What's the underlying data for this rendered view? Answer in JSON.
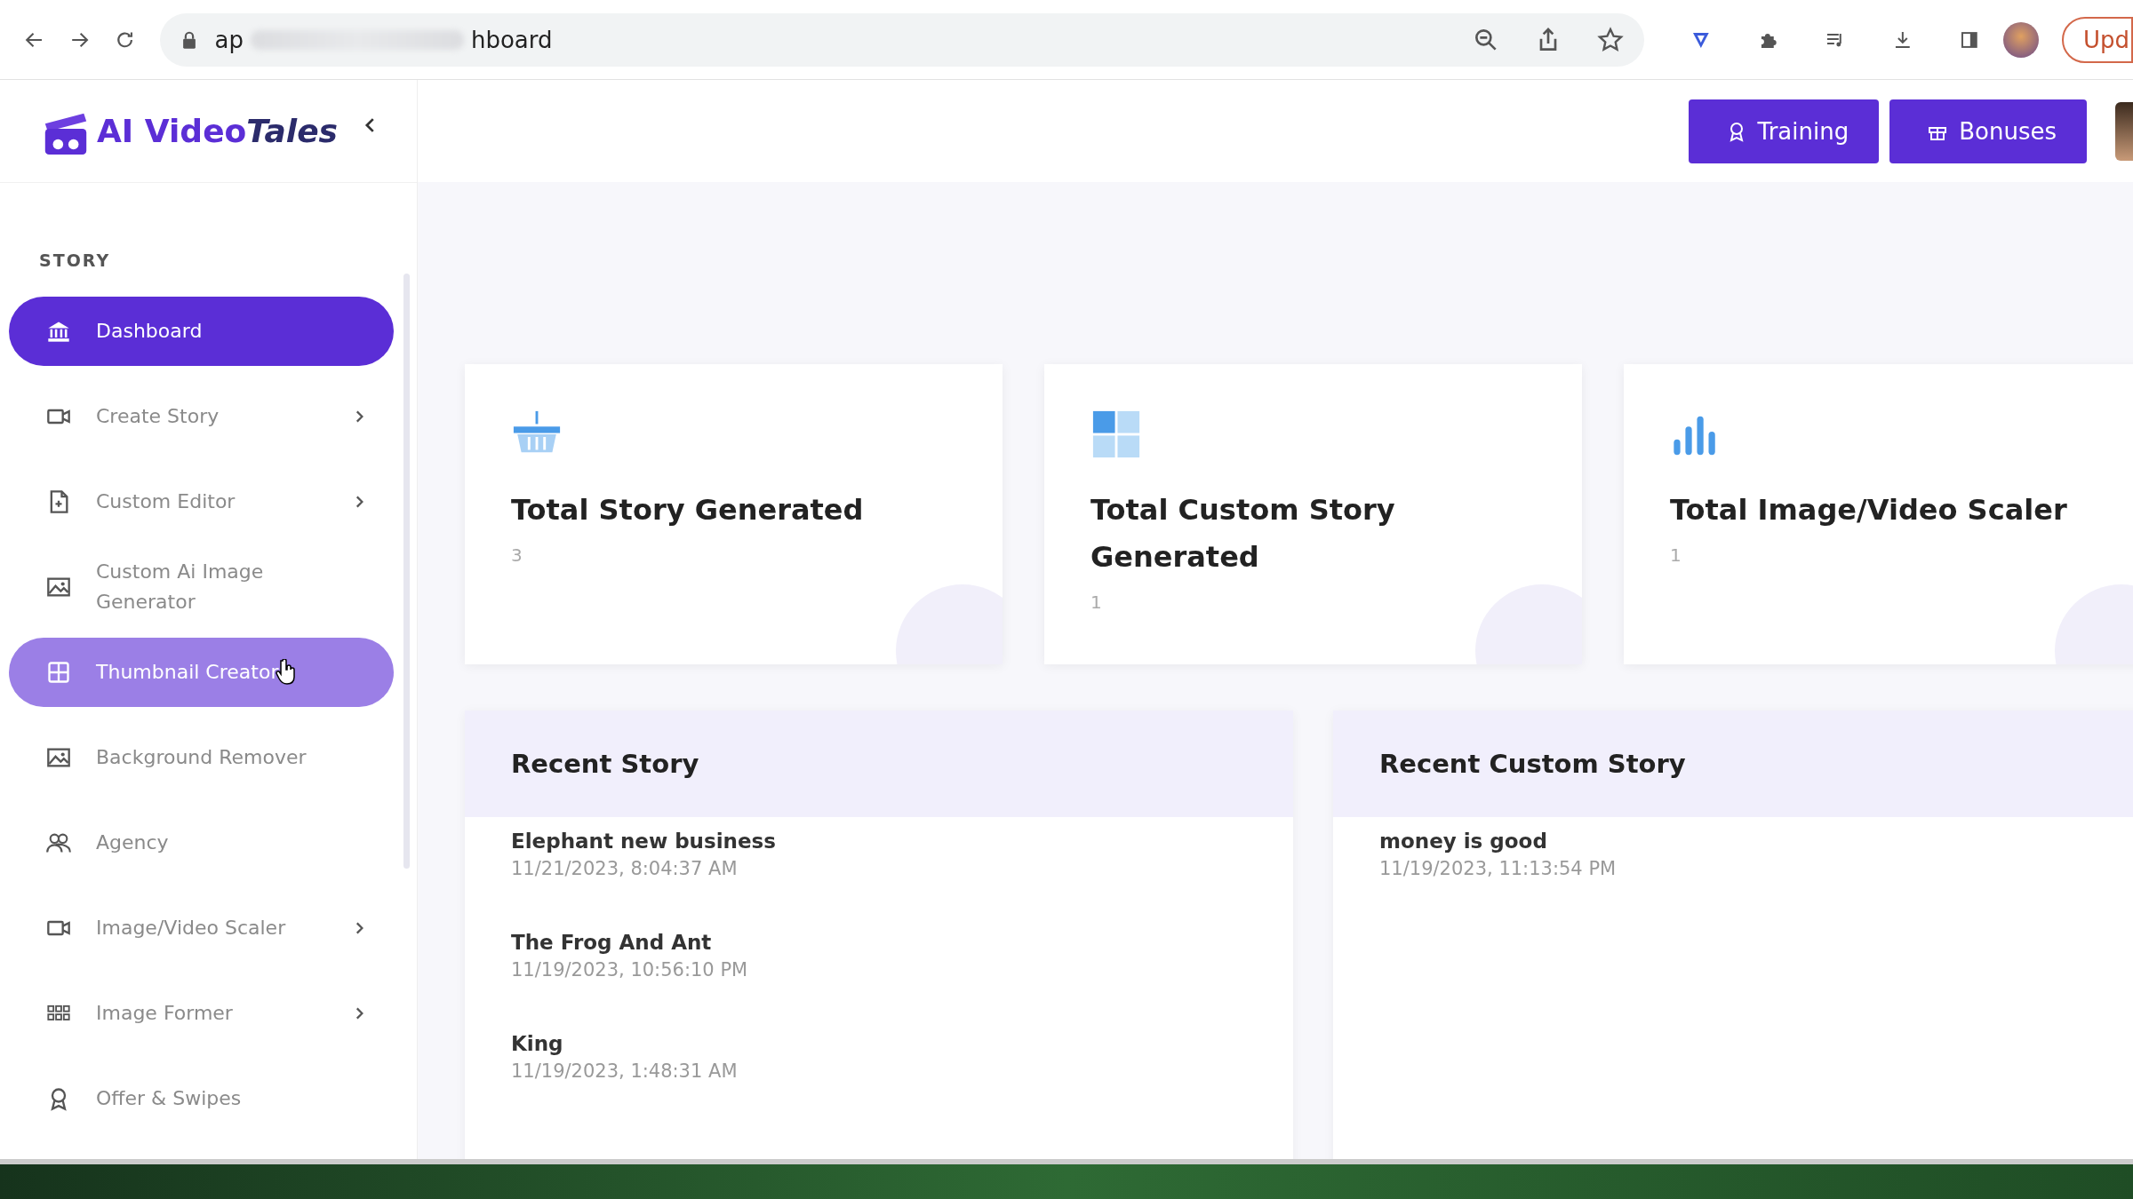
{
  "browser": {
    "url_start": "ap",
    "url_end": "hboard",
    "update_button": "Upd"
  },
  "logo": {
    "text": "AI Video",
    "accent": "Tales"
  },
  "header": {
    "buttons": [
      {
        "label": "Training",
        "kind": "training"
      },
      {
        "label": "Bonuses",
        "kind": "gift"
      }
    ]
  },
  "sidebar": {
    "section": "STORY",
    "items": [
      {
        "label": "Dashboard",
        "kind": "bank",
        "selected": true,
        "hovered": false,
        "has_submenu": false
      },
      {
        "label": "Create Story",
        "kind": "video",
        "selected": false,
        "hovered": false,
        "has_submenu": true
      },
      {
        "label": "Custom Editor",
        "kind": "file",
        "selected": false,
        "hovered": false,
        "has_submenu": true
      },
      {
        "label": "Custom Ai Image Generator",
        "kind": "image",
        "selected": false,
        "hovered": false,
        "has_submenu": false
      },
      {
        "label": "Thumbnail Creator",
        "kind": "grid",
        "selected": false,
        "hovered": true,
        "has_submenu": false
      },
      {
        "label": "Background Remover",
        "kind": "image",
        "selected": false,
        "hovered": false,
        "has_submenu": false
      },
      {
        "label": "Agency",
        "kind": "users",
        "selected": false,
        "hovered": false,
        "has_submenu": false
      },
      {
        "label": "Image/Video Scaler",
        "kind": "video",
        "selected": false,
        "hovered": false,
        "has_submenu": true
      },
      {
        "label": "Image Former",
        "kind": "dots",
        "selected": false,
        "hovered": false,
        "has_submenu": true
      },
      {
        "label": "Offer & Swipes",
        "kind": "award",
        "selected": false,
        "hovered": false,
        "has_submenu": false
      }
    ]
  },
  "stats": [
    {
      "title": "Total Story Generated",
      "value": "3",
      "kind": "basket"
    },
    {
      "title": "Total Custom Story Generated",
      "value": "1",
      "kind": "tiles"
    },
    {
      "title": "Total Image/Video Scaler",
      "value": "1",
      "kind": "bars"
    }
  ],
  "recent": [
    {
      "title": "Recent Story",
      "items": [
        {
          "name": "Elephant new business",
          "date": "11/21/2023, 8:04:37 AM"
        },
        {
          "name": "The Frog And Ant",
          "date": "11/19/2023, 10:56:10 PM"
        },
        {
          "name": "King",
          "date": "11/19/2023, 1:48:31 AM"
        }
      ]
    },
    {
      "title": "Recent Custom Story",
      "items": [
        {
          "name": "money is good",
          "date": "11/19/2023, 11:13:54 PM"
        }
      ]
    }
  ]
}
